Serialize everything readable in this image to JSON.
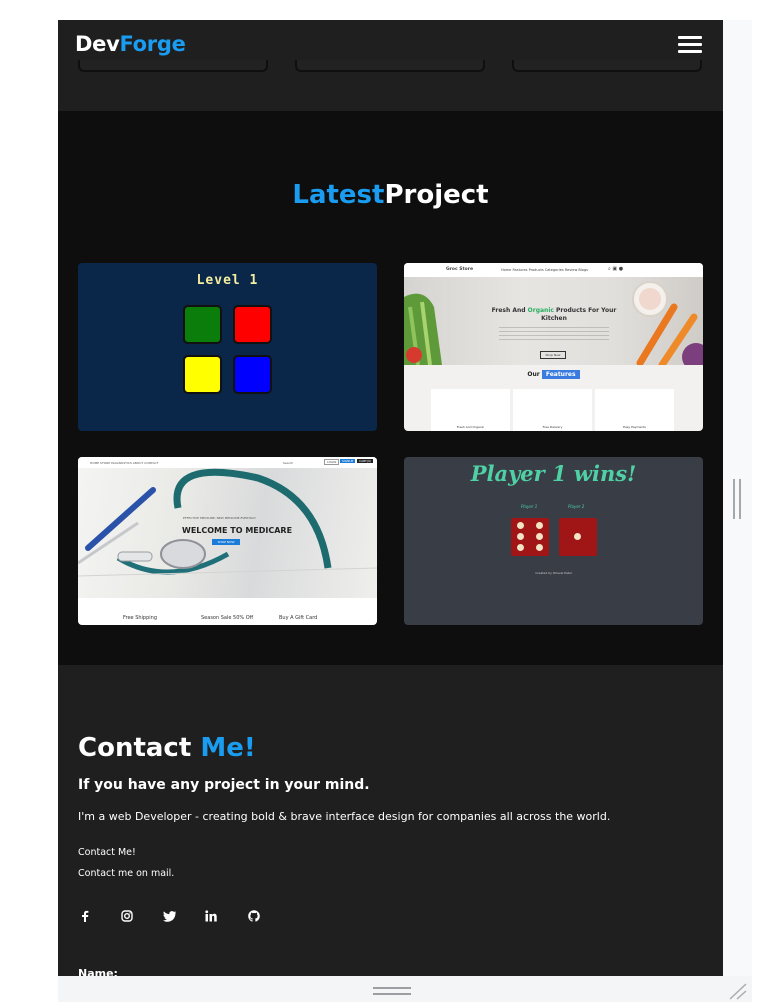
{
  "brand": {
    "part1": "Dev",
    "part2": "Forge"
  },
  "nav": {
    "menu_icon": "hamburger-icon"
  },
  "projects": {
    "title_accent": "Latest",
    "title_rest": "Project",
    "items": [
      {
        "kind": "color-game",
        "level_text": "Level 1",
        "pad_colors": [
          "#0a7d0a",
          "#ff0000",
          "#ffff00",
          "#0000ff"
        ]
      },
      {
        "kind": "grocery-store",
        "logo": "Groc Store",
        "links": "Home  Features  Products  Categories  Review  Blogs",
        "hero_title_1": "Fresh And ",
        "hero_title_accent": "Organic",
        "hero_title_2": " Products For Your Kitchen",
        "hero_button": "Shop Now",
        "features_prefix": "Our ",
        "features_tag": "Features",
        "feature_cards": [
          "Fresh And Organic",
          "Free Delivery",
          "Easy Payments"
        ]
      },
      {
        "kind": "medicare",
        "nav_links": "HOME  STORE  DIAGNOSTICS  ABOUT  CONTACT",
        "search": "Search",
        "login": "LOGIN",
        "signup": "SIGNUP",
        "cart": "CART(0)",
        "small_text": "EFFECTIVE MEDICINE, NEW MEDICINE EVERYDAY",
        "title": "WELCOME TO MEDICARE",
        "button": "SHOP NOW",
        "strip": [
          "Free Shipping",
          "Season Sale 50% Off",
          "Buy A Gift Card"
        ]
      },
      {
        "kind": "dice-game",
        "winner": "Player 1 wins!",
        "player1": "Player 1",
        "player2": "Player 2",
        "credit": "Created by Dhaval Patel"
      }
    ]
  },
  "contact": {
    "title_1": "Contact ",
    "title_accent": "Me!",
    "subtitle": "If you have any project in your mind.",
    "description": "I'm a web Developer - creating bold & brave interface design for companies all across the world.",
    "line1": "Contact Me!",
    "line2": "Contact me on mail.",
    "social": [
      "facebook-icon",
      "instagram-icon",
      "twitter-icon",
      "linkedin-icon",
      "github-icon"
    ],
    "name_label": "Name:"
  },
  "colors": {
    "accent": "#1a9cf0",
    "dark": "#1f1f1f",
    "darker": "#0e0e0e"
  }
}
